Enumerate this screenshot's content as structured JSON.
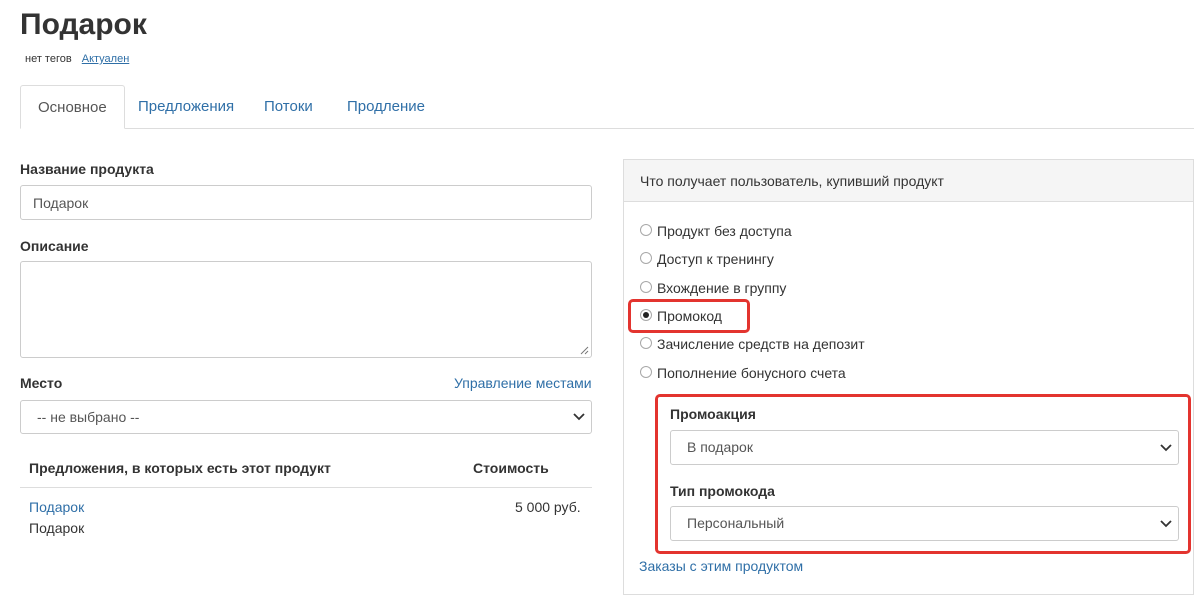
{
  "header": {
    "title": "Подарок",
    "tags_text": "нет тегов",
    "status_link": "Актуален"
  },
  "tabs": [
    {
      "label": "Основное",
      "active": true
    },
    {
      "label": "Предложения",
      "active": false
    },
    {
      "label": "Потоки",
      "active": false
    },
    {
      "label": "Продление",
      "active": false
    }
  ],
  "form": {
    "name_label": "Название продукта",
    "name_value": "Подарок",
    "description_label": "Описание",
    "description_value": "",
    "place_label": "Место",
    "place_manage_link": "Управление местами",
    "place_value": "-- не выбрано --"
  },
  "offers_table": {
    "col_offer": "Предложения, в которых есть этот продукт",
    "col_price": "Стоимость",
    "rows": [
      {
        "offer_link": "Подарок",
        "offer_sub": "Подарок",
        "price": "5 000 руб."
      }
    ]
  },
  "access_panel": {
    "title": "Что получает пользователь, купивший продукт",
    "options": [
      {
        "label": "Продукт без доступа",
        "checked": false
      },
      {
        "label": "Доступ к тренингу",
        "checked": false
      },
      {
        "label": "Вхождение в группу",
        "checked": false
      },
      {
        "label": "Промокод",
        "checked": true
      },
      {
        "label": "Зачисление средств на депозит",
        "checked": false
      },
      {
        "label": "Пополнение бонусного счета",
        "checked": false
      }
    ],
    "promo_action_label": "Промоакция",
    "promo_action_value": "В подарок",
    "promo_type_label": "Тип промокода",
    "promo_type_value": "Персональный",
    "orders_link": "Заказы с этим продуктом"
  },
  "colors": {
    "link": "#2f6fa7",
    "highlight": "#e3342f"
  }
}
